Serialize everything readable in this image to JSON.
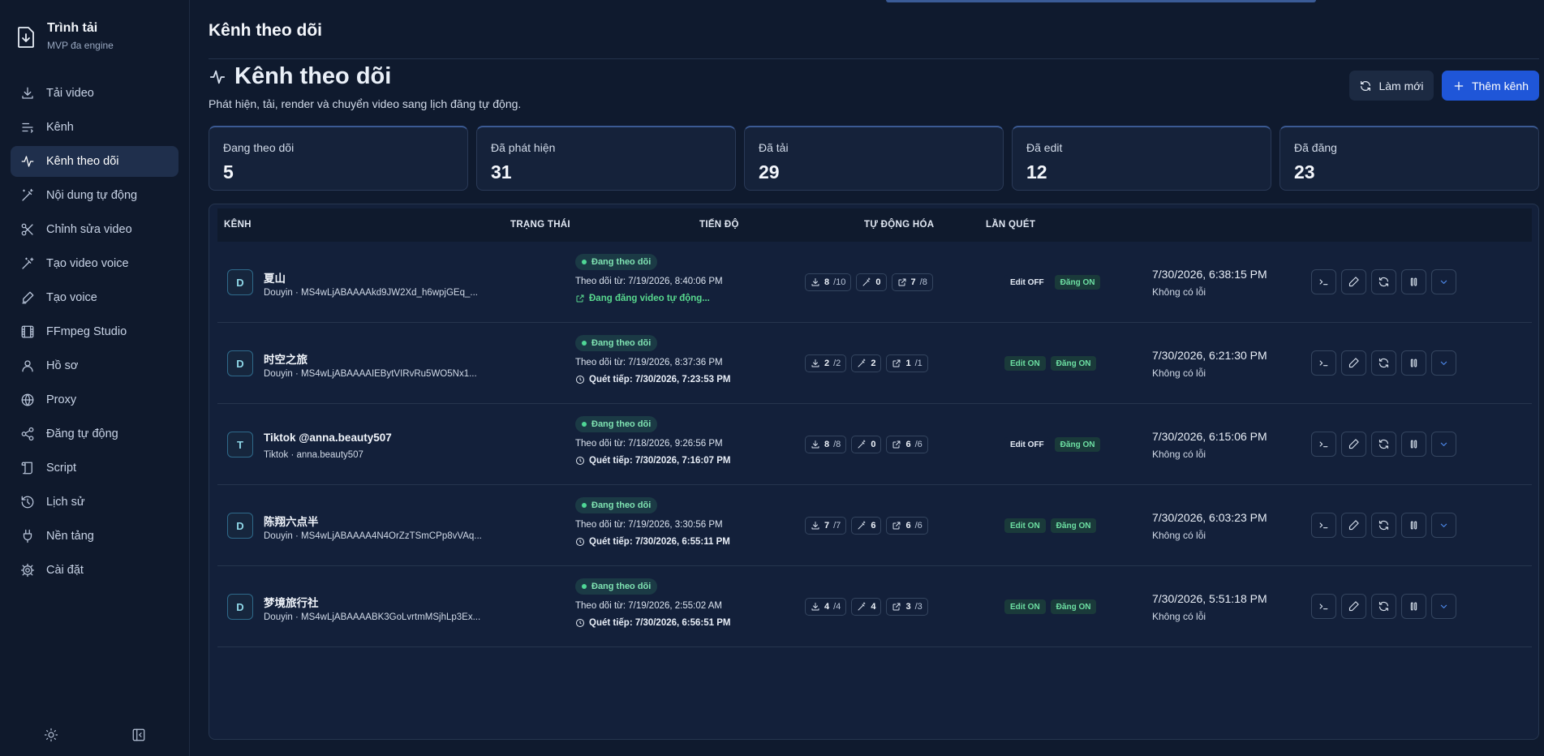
{
  "app": {
    "title": "Trình tải",
    "subtitle": "MVP đa engine"
  },
  "sidebar": {
    "items": [
      {
        "label": "Tải video",
        "icon": "download-icon"
      },
      {
        "label": "Kênh",
        "icon": "list-icon"
      },
      {
        "label": "Kênh theo dõi",
        "icon": "activity-icon",
        "active": true
      },
      {
        "label": "Nội dung tự động",
        "icon": "magic-wand-icon"
      },
      {
        "label": "Chỉnh sửa video",
        "icon": "scissors-icon"
      },
      {
        "label": "Tạo video voice",
        "icon": "wand-icon"
      },
      {
        "label": "Tạo voice",
        "icon": "pen-icon"
      },
      {
        "label": "FFmpeg Studio",
        "icon": "film-icon"
      },
      {
        "label": "Hồ sơ",
        "icon": "user-icon"
      },
      {
        "label": "Proxy",
        "icon": "globe-icon"
      },
      {
        "label": "Đăng tự động",
        "icon": "share-icon"
      },
      {
        "label": "Script",
        "icon": "scroll-icon"
      },
      {
        "label": "Lịch sử",
        "icon": "history-icon"
      },
      {
        "label": "Nền tảng",
        "icon": "plug-icon"
      },
      {
        "label": "Cài đặt",
        "icon": "gear-icon"
      }
    ]
  },
  "header": {
    "page_title": "Kênh theo dõi",
    "heading": "Kênh theo dõi",
    "subtitle": "Phát hiện, tải, render và chuyển video sang lịch đăng tự động.",
    "refresh_label": "Làm mới",
    "add_label": "Thêm kênh"
  },
  "stats": [
    {
      "label": "Đang theo dõi",
      "value": "5"
    },
    {
      "label": "Đã phát hiện",
      "value": "31"
    },
    {
      "label": "Đã tải",
      "value": "29"
    },
    {
      "label": "Đã edit",
      "value": "12"
    },
    {
      "label": "Đã đăng",
      "value": "23"
    }
  ],
  "table": {
    "columns": [
      "KÊNH",
      "TRẠNG THÁI",
      "TIẾN ĐỘ",
      "TỰ ĐỘNG HÓA",
      "LẦN QUÉT"
    ],
    "rows": [
      {
        "initial": "D",
        "name": "夏山",
        "source": "Douyin · MS4wLjABAAAAkd9JW2Xd_h6wpjGEq_...",
        "status": "Đang theo dõi",
        "since": "Theo dõi từ: 7/19/2026, 8:40:06 PM",
        "next": "Đang đăng video tự động...",
        "next_type": "posting",
        "dl": "8",
        "dl_total": "/10",
        "edit": "0",
        "post": "7",
        "post_total": "/8",
        "edit_tag": "Edit OFF",
        "edit_on": false,
        "post_tag": "Đăng ON",
        "scan_time": "7/30/2026, 6:38:15 PM",
        "scan_error": "Không có lỗi"
      },
      {
        "initial": "D",
        "name": "时空之旅",
        "source": "Douyin · MS4wLjABAAAAIEBytVIRvRu5WO5Nx1...",
        "status": "Đang theo dõi",
        "since": "Theo dõi từ: 7/19/2026, 8:37:36 PM",
        "next": "Quét tiếp: 7/30/2026, 7:23:53 PM",
        "next_type": "scan",
        "dl": "2",
        "dl_total": "/2",
        "edit": "2",
        "post": "1",
        "post_total": "/1",
        "edit_tag": "Edit ON",
        "edit_on": true,
        "post_tag": "Đăng ON",
        "scan_time": "7/30/2026, 6:21:30 PM",
        "scan_error": "Không có lỗi"
      },
      {
        "initial": "T",
        "name": "Tiktok @anna.beauty507",
        "source": "Tiktok · anna.beauty507",
        "status": "Đang theo dõi",
        "since": "Theo dõi từ: 7/18/2026, 9:26:56 PM",
        "next": "Quét tiếp: 7/30/2026, 7:16:07 PM",
        "next_type": "scan",
        "dl": "8",
        "dl_total": "/8",
        "edit": "0",
        "post": "6",
        "post_total": "/6",
        "edit_tag": "Edit OFF",
        "edit_on": false,
        "post_tag": "Đăng ON",
        "scan_time": "7/30/2026, 6:15:06 PM",
        "scan_error": "Không có lỗi"
      },
      {
        "initial": "D",
        "name": "陈翔六点半",
        "source": "Douyin · MS4wLjABAAAA4N4OrZzTSmCPp8vVAq...",
        "status": "Đang theo dõi",
        "since": "Theo dõi từ: 7/19/2026, 3:30:56 PM",
        "next": "Quét tiếp: 7/30/2026, 6:55:11 PM",
        "next_type": "scan",
        "dl": "7",
        "dl_total": "/7",
        "edit": "6",
        "post": "6",
        "post_total": "/6",
        "edit_tag": "Edit ON",
        "edit_on": true,
        "post_tag": "Đăng ON",
        "scan_time": "7/30/2026, 6:03:23 PM",
        "scan_error": "Không có lỗi"
      },
      {
        "initial": "D",
        "name": "梦境旅行社",
        "source": "Douyin · MS4wLjABAAAABK3GoLvrtmMSjhLp3Ex...",
        "status": "Đang theo dõi",
        "since": "Theo dõi từ: 7/19/2026, 2:55:02 AM",
        "next": "Quét tiếp: 7/30/2026, 6:56:51 PM",
        "next_type": "scan",
        "dl": "4",
        "dl_total": "/4",
        "edit": "4",
        "post": "3",
        "post_total": "/3",
        "edit_tag": "Edit ON",
        "edit_on": true,
        "post_tag": "Đăng ON",
        "scan_time": "7/30/2026, 5:51:18 PM",
        "scan_error": "Không có lỗi"
      }
    ]
  },
  "colors": {
    "background": "#0f1a2e",
    "accent": "#1f56d8",
    "status_green": "#4fd796"
  }
}
